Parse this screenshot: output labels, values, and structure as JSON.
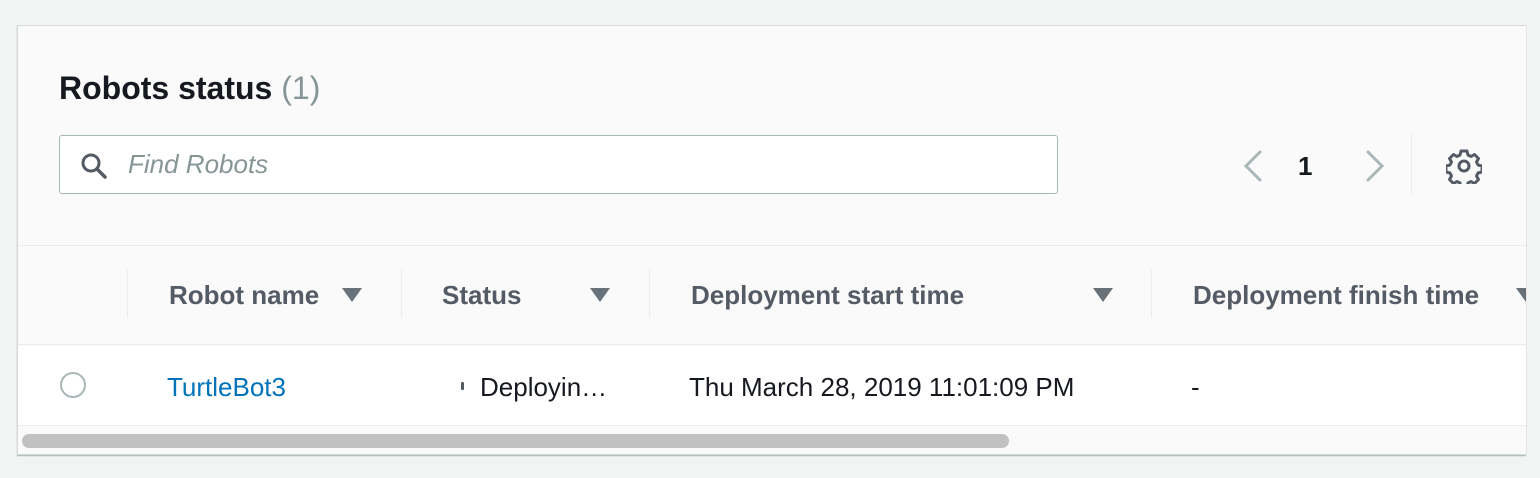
{
  "header": {
    "title": "Robots status",
    "count": "(1)"
  },
  "search": {
    "placeholder": "Find Robots",
    "value": ""
  },
  "pagination": {
    "current_page": "1"
  },
  "icons": {
    "search": "search-icon",
    "prev": "chevron-left-icon",
    "next": "chevron-right-icon",
    "settings": "gear-icon",
    "sort": "caret-down-icon"
  },
  "table": {
    "columns": [
      {
        "label": "Robot name"
      },
      {
        "label": "Status"
      },
      {
        "label": "Deployment start time"
      },
      {
        "label": "Deployment finish time"
      }
    ],
    "rows": [
      {
        "robot_name": "TurtleBot3",
        "status": "Deploying...",
        "start_time": "Thu March 28, 2019 11:01:09 PM",
        "finish_time": "-"
      }
    ]
  },
  "colors": {
    "link": "#0073bb",
    "muted": "#879596",
    "border": "#aab7b8"
  }
}
